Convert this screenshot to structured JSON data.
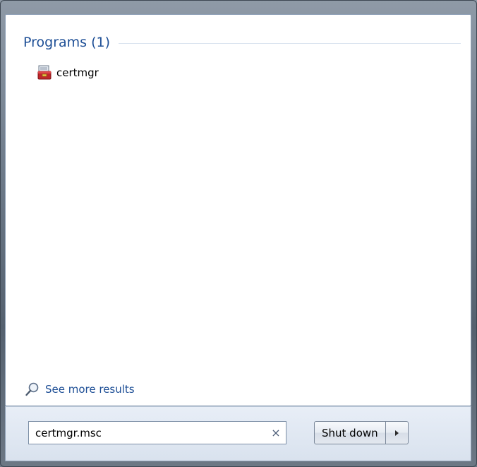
{
  "results": {
    "group_title": "Programs (1)",
    "items": [
      {
        "label": "certmgr",
        "icon": "certmgr-toolbox-icon"
      }
    ],
    "see_more_label": "See more results"
  },
  "search": {
    "value": "certmgr.msc",
    "clear_glyph": "×"
  },
  "power": {
    "shutdown_label": "Shut down"
  },
  "colors": {
    "group_title": "#1e4f96",
    "link": "#1e4f96"
  }
}
